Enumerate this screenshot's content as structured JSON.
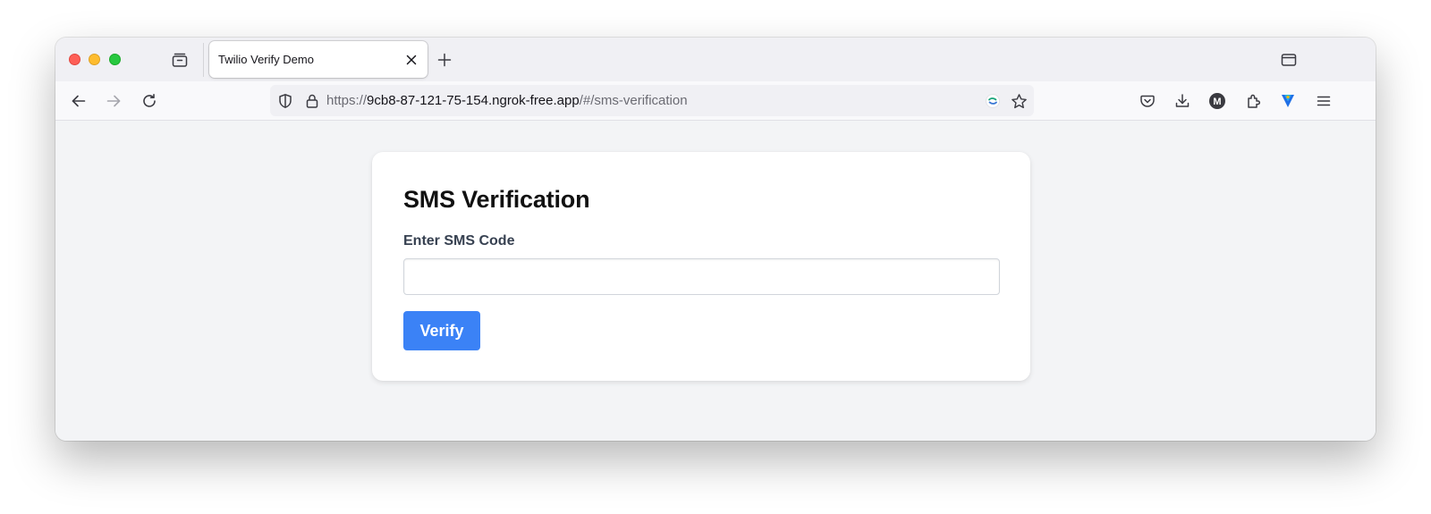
{
  "browser": {
    "tab": {
      "title": "Twilio Verify Demo"
    },
    "url": {
      "scheme": "https://",
      "host": "9cb8-87-121-75-154.ngrok-free.app",
      "path": "/#/sms-verification"
    },
    "icons": {
      "back": "arrow-left-icon",
      "forward": "arrow-right-icon",
      "reload": "reload-icon",
      "shield": "shield-icon",
      "lock": "lock-icon",
      "bookmark": "star-icon",
      "pocket": "pocket-icon",
      "downloads": "download-icon",
      "account": "account-icon",
      "extensions": "puzzle-icon",
      "menu": "hamburger-menu-icon"
    },
    "account_initial": "M"
  },
  "page": {
    "title": "SMS Verification",
    "field_label": "Enter SMS Code",
    "input_value": "",
    "button_label": "Verify"
  },
  "colors": {
    "primary_button": "#3b82f6",
    "page_background": "#f3f4f6",
    "card_background": "#ffffff"
  }
}
